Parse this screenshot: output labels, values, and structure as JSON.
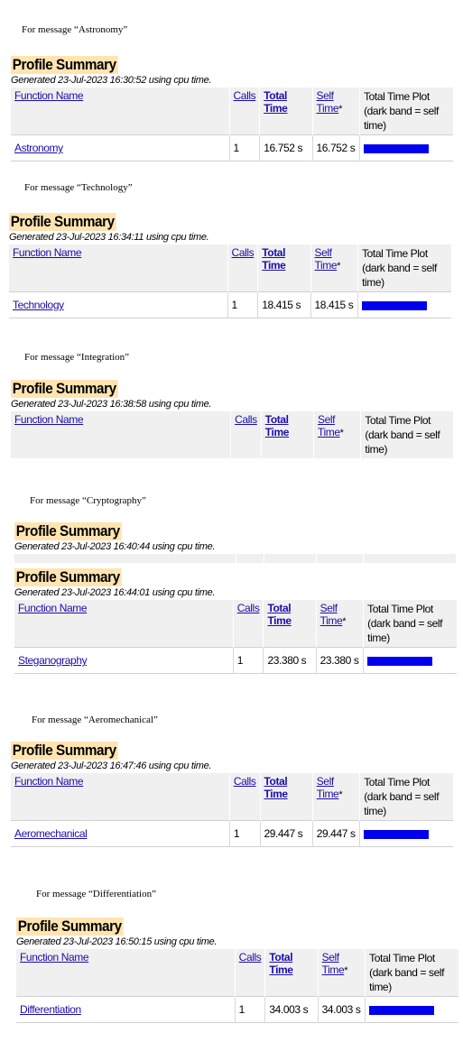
{
  "labels": {
    "profile_summary": "Profile Summary",
    "function_name": "Function Name",
    "calls": "Calls",
    "total_time": "Total Time",
    "self_time": "Self Time",
    "asterisk": "*",
    "plot_line1": "Total Time Plot",
    "plot_line2": "(dark band = self time)"
  },
  "bar_color": "#0000ee",
  "sections": [
    {
      "caption": "For message “Astronomy”",
      "profiles": [
        {
          "generated": "Generated 23-Jul-2023 16:30:52 using cpu time.",
          "row": {
            "name": "Astronomy",
            "calls": "1",
            "total": "16.752 s",
            "self": "16.752 s"
          }
        }
      ]
    },
    {
      "caption": "For message “Technology”",
      "profiles": [
        {
          "generated": "Generated 23-Jul-2023 16:34:11 using cpu time.",
          "row": {
            "name": "Technology",
            "calls": "1",
            "total": "18.415 s",
            "self": "18.415 s"
          }
        }
      ]
    },
    {
      "caption": "For message “Integration”",
      "profiles": [
        {
          "generated": "Generated 23-Jul-2023 16:38:58 using cpu time."
        }
      ]
    },
    {
      "caption": "For message “Cryptography”",
      "profiles": [
        {
          "generated": "Generated 23-Jul-2023 16:40:44 using cpu time."
        },
        {
          "generated": "Generated 23-Jul-2023 16:44:01 using cpu time.",
          "row": {
            "name": "Steganography",
            "calls": "1",
            "total": "23.380 s",
            "self": "23.380 s"
          }
        }
      ]
    },
    {
      "caption": "For message “Aeromechanical”",
      "profiles": [
        {
          "generated": "Generated 23-Jul-2023 16:47:46 using cpu time.",
          "row": {
            "name": "Aeromechanical",
            "calls": "1",
            "total": "29.447 s",
            "self": "29.447 s"
          }
        }
      ]
    },
    {
      "caption": "For message “Differentiation”",
      "profiles": [
        {
          "generated": "Generated 23-Jul-2023 16:50:15 using cpu time.",
          "row": {
            "name": "Differentiation",
            "calls": "1",
            "total": "34.003 s",
            "self": "34.003 s"
          }
        }
      ]
    }
  ]
}
